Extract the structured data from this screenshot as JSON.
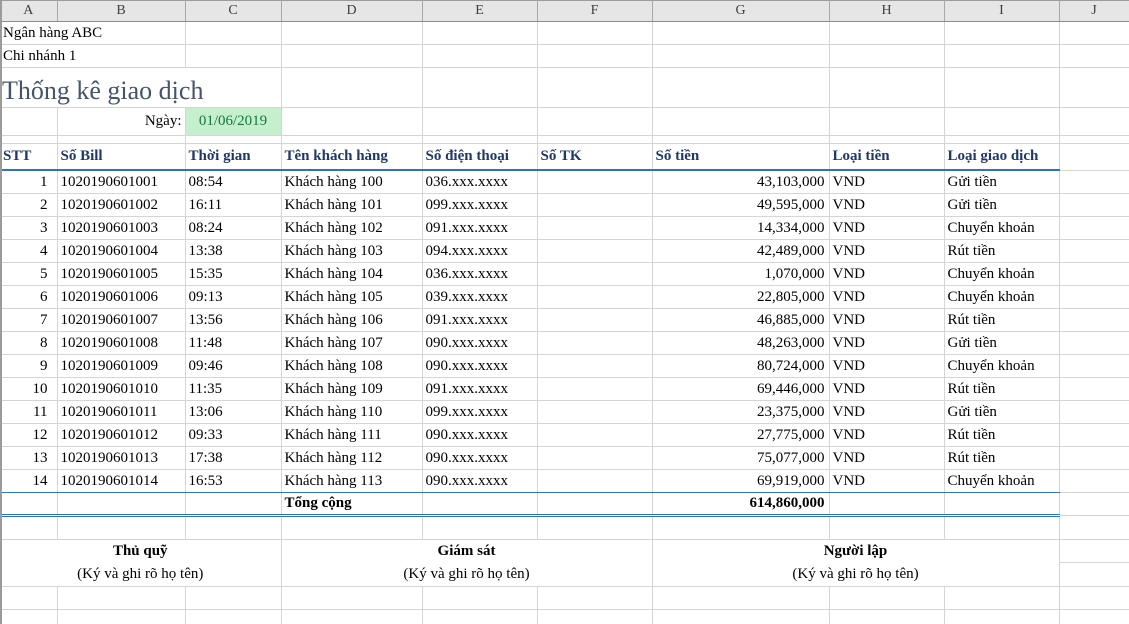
{
  "app": "spreadsheet",
  "columns": [
    "A",
    "B",
    "C",
    "D",
    "E",
    "F",
    "G",
    "H",
    "I",
    "J"
  ],
  "info": {
    "bank": "Ngân hàng ABC",
    "branch": "Chi nhánh 1"
  },
  "title": "Thống kê giao dịch",
  "date_label": "Ngày:",
  "date_value": "01/06/2019",
  "table": {
    "headers": [
      "STT",
      "Số Bill",
      "Thời gian",
      "Tên khách hàng",
      "Số điện thoại",
      "Số TK",
      "Số tiền",
      "Loại tiền",
      "Loại giao dịch"
    ],
    "rows": [
      [
        "1",
        "1020190601001",
        "08:54",
        "Khách hàng 100",
        "036.xxx.xxxx",
        "",
        "43,103,000",
        "VND",
        "Gửi tiền"
      ],
      [
        "2",
        "1020190601002",
        "16:11",
        "Khách hàng 101",
        "099.xxx.xxxx",
        "",
        "49,595,000",
        "VND",
        "Gửi tiền"
      ],
      [
        "3",
        "1020190601003",
        "08:24",
        "Khách hàng 102",
        "091.xxx.xxxx",
        "",
        "14,334,000",
        "VND",
        "Chuyển khoản"
      ],
      [
        "4",
        "1020190601004",
        "13:38",
        "Khách hàng 103",
        "094.xxx.xxxx",
        "",
        "42,489,000",
        "VND",
        "Rút tiền"
      ],
      [
        "5",
        "1020190601005",
        "15:35",
        "Khách hàng 104",
        "036.xxx.xxxx",
        "",
        "1,070,000",
        "VND",
        "Chuyển khoản"
      ],
      [
        "6",
        "1020190601006",
        "09:13",
        "Khách hàng 105",
        "039.xxx.xxxx",
        "",
        "22,805,000",
        "VND",
        "Chuyển khoản"
      ],
      [
        "7",
        "1020190601007",
        "13:56",
        "Khách hàng 106",
        "091.xxx.xxxx",
        "",
        "46,885,000",
        "VND",
        "Rút tiền"
      ],
      [
        "8",
        "1020190601008",
        "11:48",
        "Khách hàng 107",
        "090.xxx.xxxx",
        "",
        "48,263,000",
        "VND",
        "Gửi tiền"
      ],
      [
        "9",
        "1020190601009",
        "09:46",
        "Khách hàng 108",
        "090.xxx.xxxx",
        "",
        "80,724,000",
        "VND",
        "Chuyển khoản"
      ],
      [
        "10",
        "1020190601010",
        "11:35",
        "Khách hàng 109",
        "091.xxx.xxxx",
        "",
        "69,446,000",
        "VND",
        "Rút tiền"
      ],
      [
        "11",
        "1020190601011",
        "13:06",
        "Khách hàng 110",
        "099.xxx.xxxx",
        "",
        "23,375,000",
        "VND",
        "Gửi tiền"
      ],
      [
        "12",
        "1020190601012",
        "09:33",
        "Khách hàng 111",
        "090.xxx.xxxx",
        "",
        "27,775,000",
        "VND",
        "Rút tiền"
      ],
      [
        "13",
        "1020190601013",
        "17:38",
        "Khách hàng 112",
        "090.xxx.xxxx",
        "",
        "75,077,000",
        "VND",
        "Rút tiền"
      ],
      [
        "14",
        "1020190601014",
        "16:53",
        "Khách hàng 113",
        "090.xxx.xxxx",
        "",
        "69,919,000",
        "VND",
        "Chuyển khoản"
      ]
    ],
    "total_label": "Tổng cộng",
    "total_value": "614,860,000"
  },
  "signatures": [
    {
      "title": "Thủ quỹ",
      "note": "(Ký và ghi rõ họ tên)"
    },
    {
      "title": "Giám sát",
      "note": "(Ký và ghi rõ họ tên)"
    },
    {
      "title": "Người lập",
      "note": "(Ký và ghi rõ họ tên)"
    }
  ],
  "colors": {
    "accent_blue_border": "#2E75B6",
    "header_text": "#1F3864",
    "title_text": "#44546A",
    "date_bg": "#C6EFCE",
    "date_text": "#0E7A38",
    "gridline": "#D5D5D5",
    "column_strip_bg": "#E7E6E6"
  }
}
